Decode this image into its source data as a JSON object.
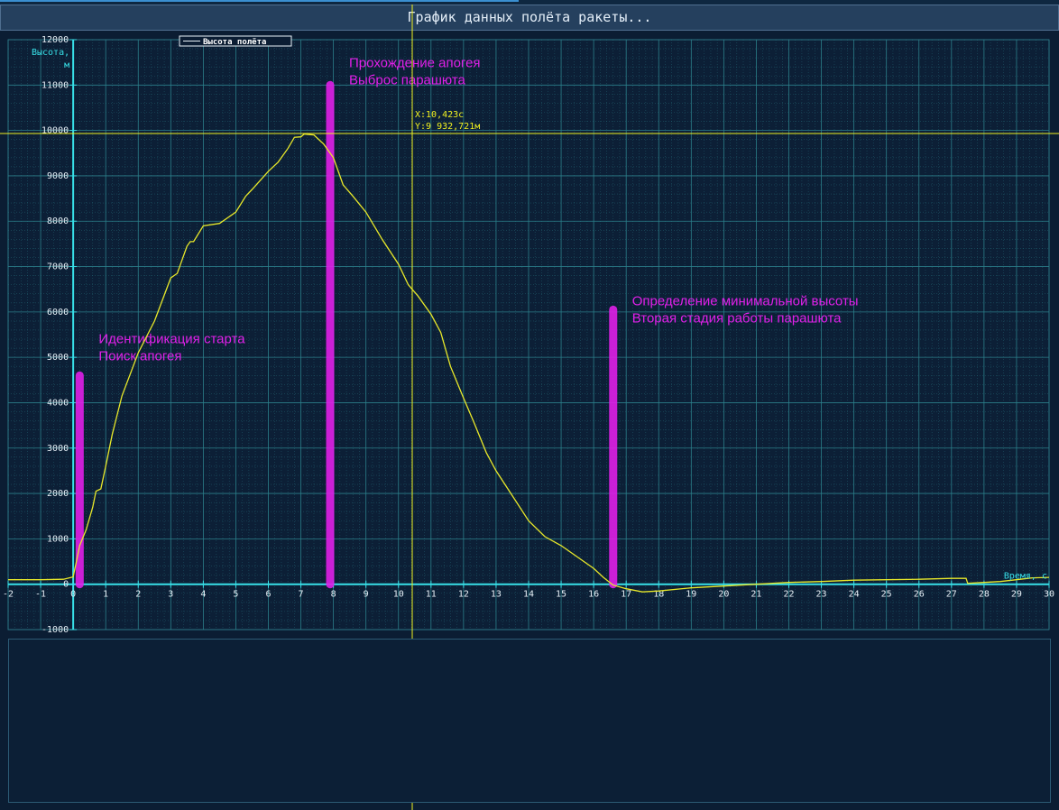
{
  "window": {
    "title": "График данных полёта ракеты..."
  },
  "colors": {
    "background": "#0b1d33",
    "grid": "#2b7f8a",
    "axis": "#38e0e8",
    "line": "#e8e82a",
    "marker": "#e020e8",
    "cursor": "#f0f020"
  },
  "cursor": {
    "x_label": "X:10,423с",
    "y_label": "Y:9 932,721м",
    "x": 10.423,
    "y": 9932.721
  },
  "chart_data": {
    "type": "line",
    "xlabel": "Время, с",
    "ylabel": [
      "Высота,",
      "м"
    ],
    "xlim": [
      -2,
      30
    ],
    "ylim": [
      -1000,
      12000
    ],
    "x_ticks": [
      -2,
      -1,
      0,
      1,
      2,
      3,
      4,
      5,
      6,
      7,
      8,
      9,
      10,
      11,
      12,
      13,
      14,
      15,
      16,
      17,
      18,
      19,
      20,
      21,
      22,
      23,
      24,
      25,
      26,
      27,
      28,
      29,
      30
    ],
    "y_ticks": [
      -1000,
      0,
      1000,
      2000,
      3000,
      4000,
      5000,
      6000,
      7000,
      8000,
      9000,
      10000,
      11000,
      12000
    ],
    "grid": true,
    "legend_position": "top-left",
    "series": [
      {
        "name": "Высота полёта",
        "points": [
          [
            -2,
            100
          ],
          [
            -1,
            100
          ],
          [
            -0.3,
            110
          ],
          [
            0,
            160
          ],
          [
            0.1,
            500
          ],
          [
            0.2,
            850
          ],
          [
            0.4,
            1200
          ],
          [
            0.6,
            1700
          ],
          [
            0.7,
            2050
          ],
          [
            0.85,
            2100
          ],
          [
            1,
            2600
          ],
          [
            1.2,
            3300
          ],
          [
            1.5,
            4150
          ],
          [
            2,
            5100
          ],
          [
            2.5,
            5800
          ],
          [
            3,
            6750
          ],
          [
            3.2,
            6850
          ],
          [
            3.5,
            7450
          ],
          [
            3.6,
            7550
          ],
          [
            3.7,
            7550
          ],
          [
            4,
            7900
          ],
          [
            4.5,
            7950
          ],
          [
            5,
            8200
          ],
          [
            5.3,
            8550
          ],
          [
            5.5,
            8700
          ],
          [
            6,
            9100
          ],
          [
            6.3,
            9300
          ],
          [
            6.6,
            9600
          ],
          [
            6.8,
            9850
          ],
          [
            7,
            9860
          ],
          [
            7.1,
            9920
          ],
          [
            7.4,
            9900
          ],
          [
            7.7,
            9700
          ],
          [
            8,
            9400
          ],
          [
            8.3,
            8800
          ],
          [
            8.6,
            8550
          ],
          [
            9,
            8200
          ],
          [
            9.5,
            7600
          ],
          [
            10,
            7050
          ],
          [
            10.3,
            6600
          ],
          [
            10.6,
            6350
          ],
          [
            11,
            5950
          ],
          [
            11.3,
            5550
          ],
          [
            11.6,
            4800
          ],
          [
            12,
            4100
          ],
          [
            12.3,
            3600
          ],
          [
            12.7,
            2900
          ],
          [
            13,
            2500
          ],
          [
            13.5,
            1950
          ],
          [
            14,
            1400
          ],
          [
            14.5,
            1050
          ],
          [
            15,
            850
          ],
          [
            15.5,
            600
          ],
          [
            16,
            350
          ],
          [
            16.3,
            150
          ],
          [
            16.6,
            -20
          ],
          [
            17,
            -100
          ],
          [
            17.5,
            -170
          ],
          [
            18,
            -150
          ],
          [
            19,
            -80
          ],
          [
            20,
            -40
          ],
          [
            21,
            0
          ],
          [
            22,
            40
          ],
          [
            23,
            60
          ],
          [
            24,
            90
          ],
          [
            25,
            100
          ],
          [
            26,
            110
          ],
          [
            27,
            130
          ],
          [
            27.45,
            130
          ],
          [
            27.5,
            20
          ],
          [
            28,
            40
          ],
          [
            28.5,
            60
          ],
          [
            29,
            100
          ],
          [
            29.5,
            140
          ],
          [
            30,
            150
          ]
        ]
      }
    ],
    "markers": [
      {
        "x": 0.2,
        "y_from": 0,
        "y_to": 4600,
        "lines": [
          "Идентификация старта",
          "Поиск апогея"
        ]
      },
      {
        "x": 7.9,
        "y_from": 0,
        "y_to": 11000,
        "lines": [
          "Прохождение апогея",
          "Выброс парашюта"
        ]
      },
      {
        "x": 16.6,
        "y_from": 0,
        "y_to": 6050,
        "lines": [
          "Определение минимальной высоты",
          "Вторая стадия работы парашюта"
        ]
      }
    ]
  }
}
